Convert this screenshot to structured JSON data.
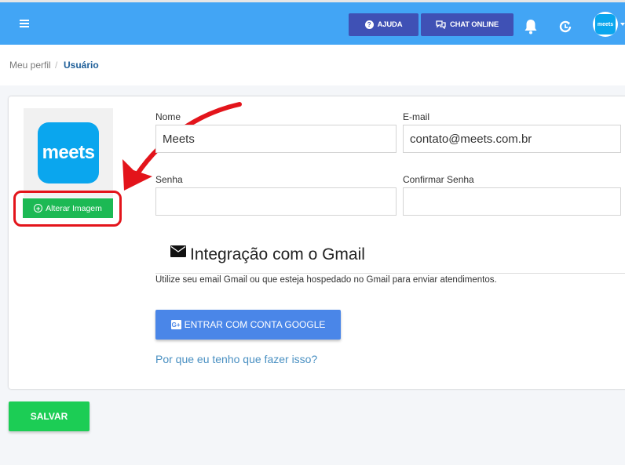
{
  "header": {
    "help_label": "AJUDA",
    "chat_label": "CHAT ONLINE",
    "avatar_text": "meets",
    "accent_color": "#42a5f5"
  },
  "breadcrumb": {
    "items": [
      "Meu perfil",
      "Usuário"
    ],
    "separator": "/"
  },
  "profile": {
    "logo_text": "meets",
    "change_image_label": "Alterar Imagem"
  },
  "form": {
    "name_label": "Nome",
    "name_value": "Meets",
    "email_label": "E-mail",
    "email_value": "contato@meets.com.br",
    "password_label": "Senha",
    "password_value": "",
    "confirm_label": "Confirmar Senha",
    "confirm_value": ""
  },
  "gmail": {
    "title": "Integração com o Gmail",
    "description": "Utilize seu email Gmail ou que esteja hospedado no Gmail para enviar atendimentos.",
    "google_icon_text": "G+",
    "button_label": "ENTRAR COM CONTA GOOGLE",
    "link": "Por que eu tenho que fazer isso?"
  },
  "save_label": "SALVAR",
  "icons": {
    "menu": "hamburger-icon",
    "help": "question-circle-icon",
    "chat": "chat-bubbles-icon",
    "bell": "bell-icon",
    "refresh": "refresh-clock-icon",
    "mail": "envelope-icon"
  }
}
